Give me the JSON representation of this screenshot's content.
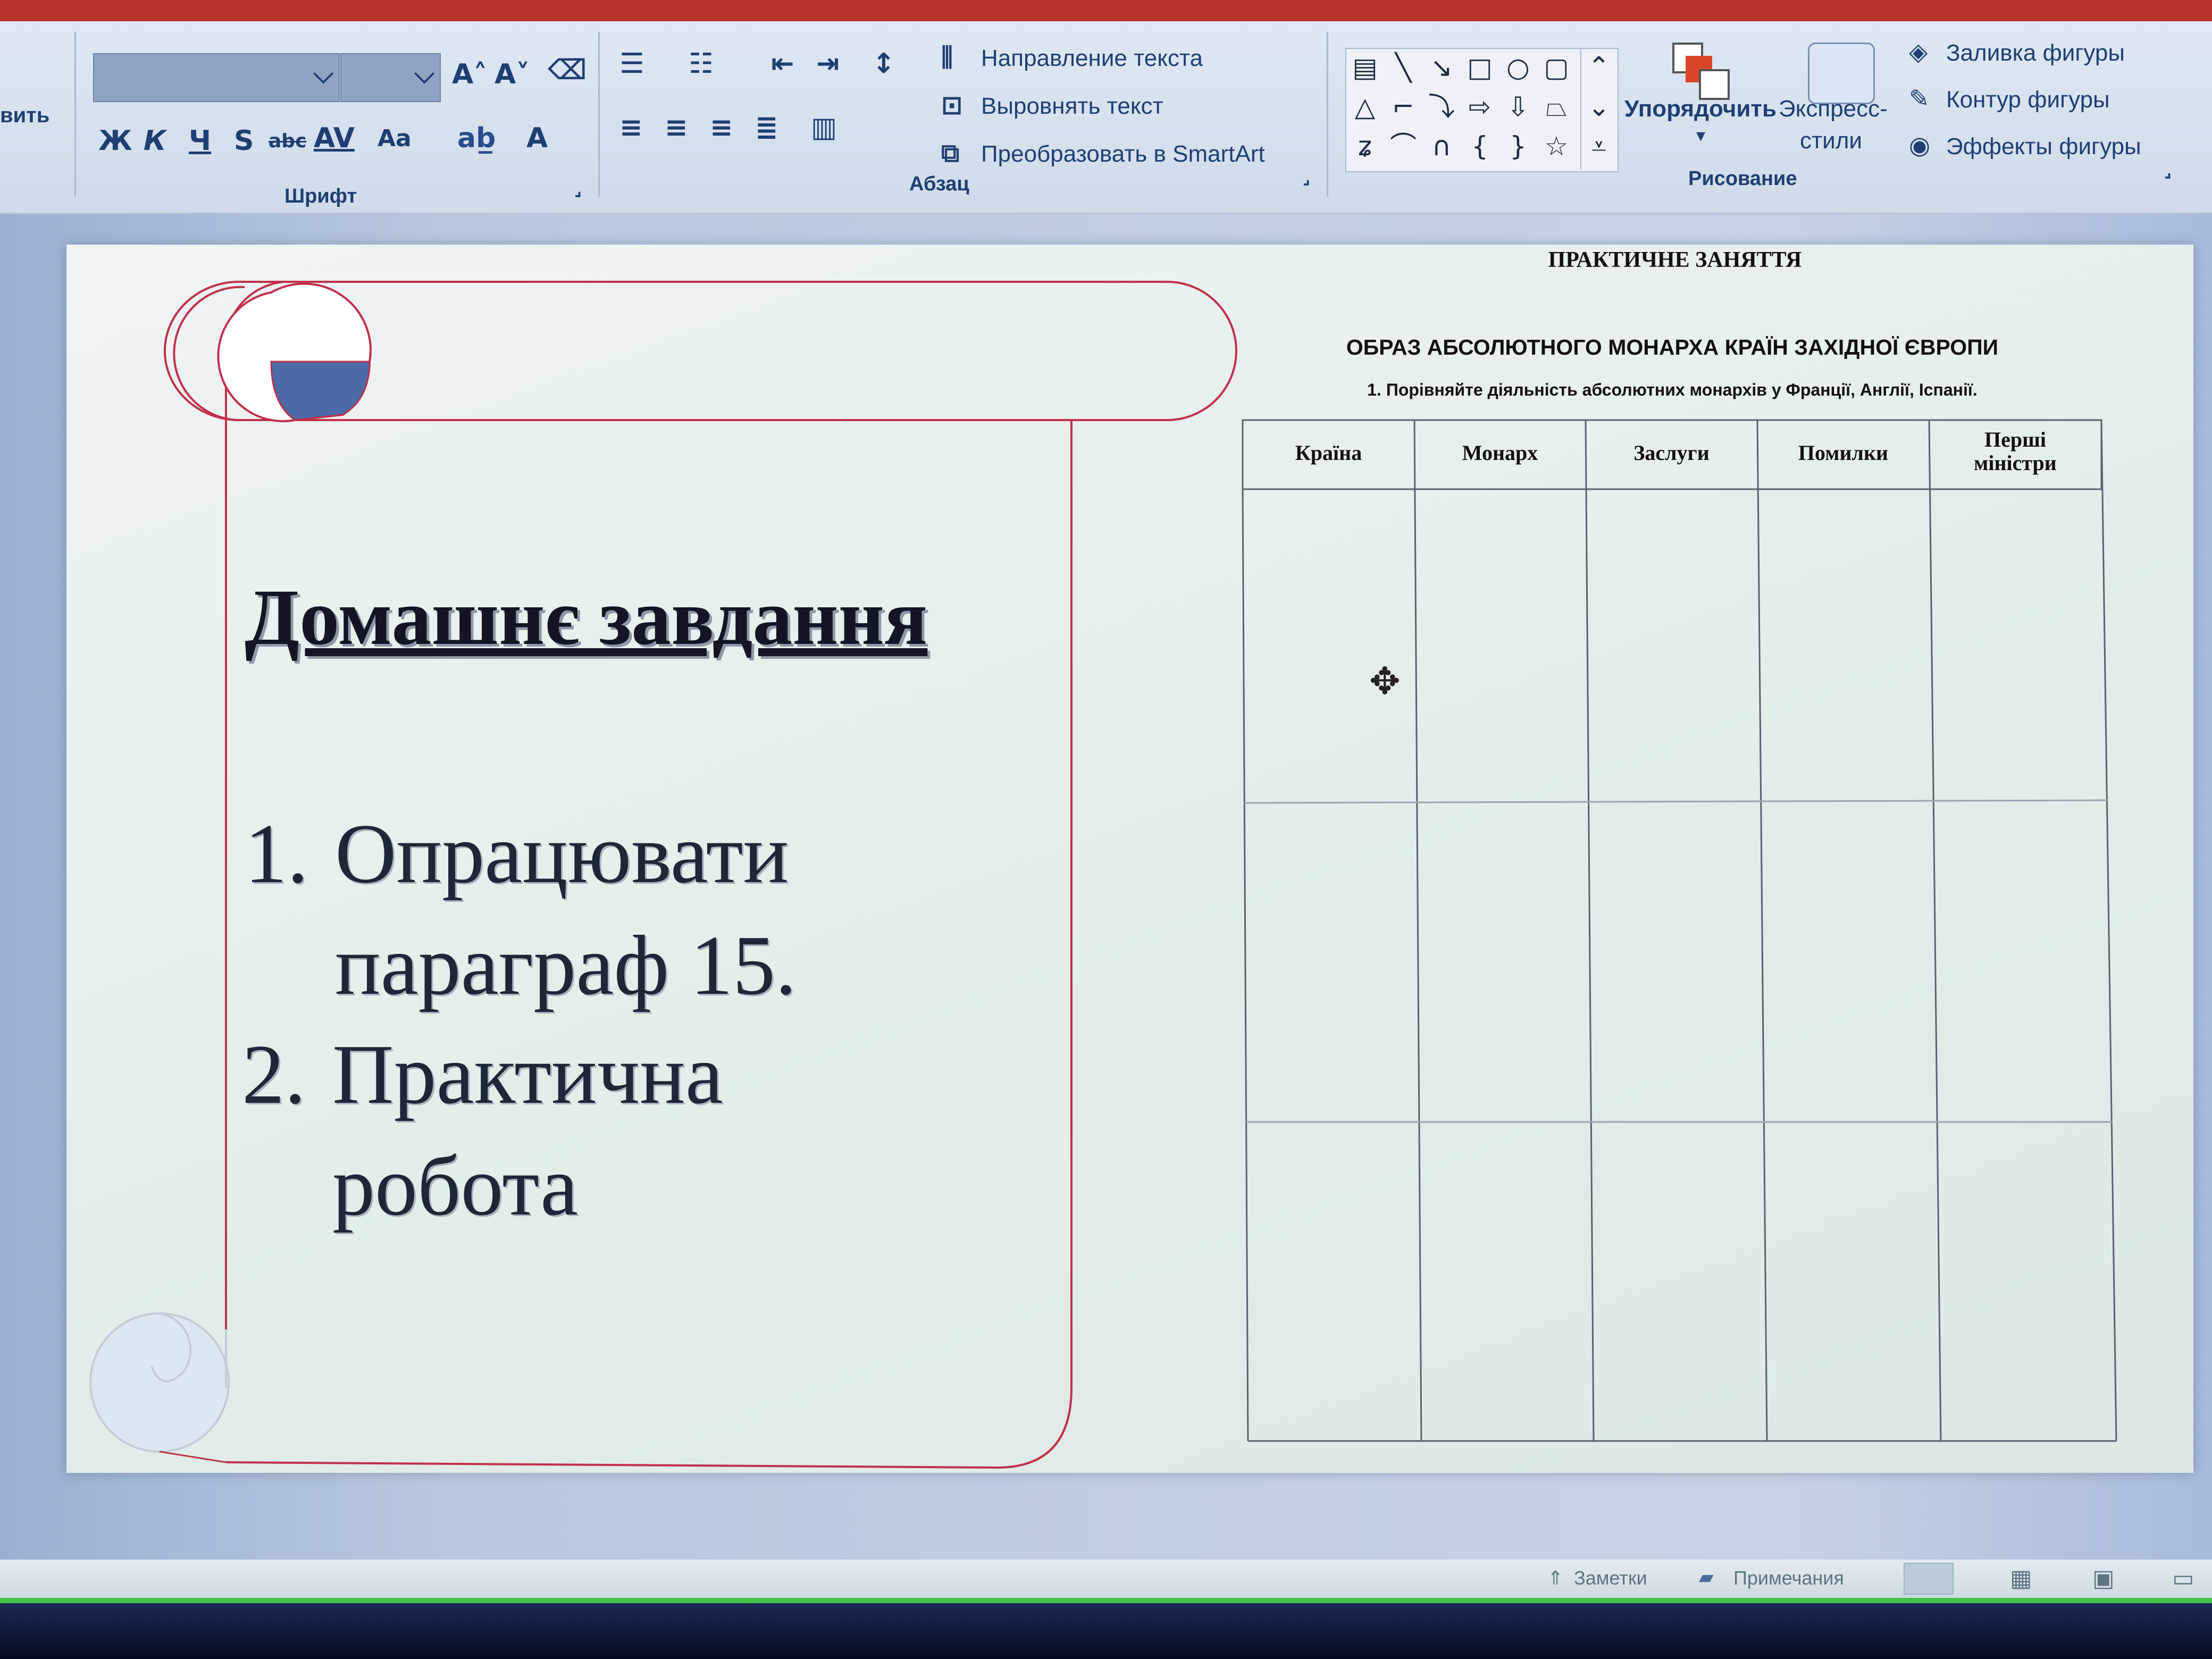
{
  "ribbon": {
    "left_cut_label": "вить",
    "font_group": {
      "label": "Шрифт",
      "grow_font": "A˄",
      "shrink_font": "A˅",
      "bold": "Ж",
      "italic": "К",
      "underline": "Ч",
      "shadow": "S",
      "strikethrough": "abc",
      "spacing": "AV",
      "case": "Aa",
      "font_color": "A"
    },
    "paragraph_group": {
      "label": "Абзац",
      "text_direction": "Направление текста",
      "align_text": "Выровнять текст",
      "convert_smartart": "Преобразовать в SmartArt"
    },
    "drawing_group": {
      "label": "Рисование",
      "arrange": "Упорядочить",
      "quick_styles_line1": "Экспресс-",
      "quick_styles_line2": "стили",
      "shape_fill": "Заливка фигуры",
      "shape_outline": "Контур фигуры",
      "shape_effects": "Эффекты фигуры"
    }
  },
  "slide": {
    "homework_title": "Домашнє завдання",
    "items": [
      {
        "num": "1.",
        "line1": "Опрацювати",
        "line2": "параграф 15."
      },
      {
        "num": "2.",
        "line1": "Практична",
        "line2": "робота"
      }
    ],
    "document": {
      "title": "ПРАКТИЧНЕ ЗАНЯТТЯ",
      "subtitle": "ОБРАЗ АБСОЛЮТНОГО МОНАРХА КРАЇН ЗАХІДНОЇ ЄВРОПИ",
      "task": "1. Порівняйте діяльність абсолютних монархів у Франції, Англії, Іспанії.",
      "columns": [
        "Країна",
        "Монарх",
        "Заслуги",
        "Помилки",
        "Перші міністри"
      ],
      "row_count": 3
    }
  },
  "statusbar": {
    "notes": "Заметки",
    "comments": "Примечания"
  },
  "colors": {
    "scroll_outline": "#c0304a",
    "scroll_curl_fill": "#4b6aa6",
    "ribbon_text": "#1f3f73",
    "status_green": "#44c24a"
  }
}
